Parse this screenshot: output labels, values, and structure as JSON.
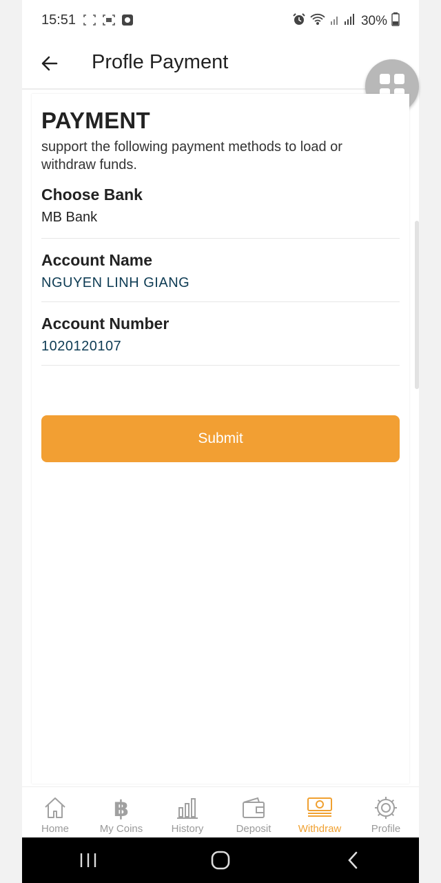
{
  "status_bar": {
    "time": "15:51",
    "battery": "30%"
  },
  "app_bar": {
    "title": "Profle Payment"
  },
  "content": {
    "heading": "PAYMENT",
    "description": "support the following payment methods to load or withdraw funds.",
    "fields": [
      {
        "label": "Choose Bank",
        "value": "MB Bank"
      },
      {
        "label": "Account Name",
        "value": "NGUYEN LINH GIANG"
      },
      {
        "label": "Account Number",
        "value": "1020120107"
      }
    ],
    "submit_label": "Submit"
  },
  "bottom_nav": {
    "items": [
      {
        "label": "Home",
        "icon": "home-icon"
      },
      {
        "label": "My Coins",
        "icon": "bitcoin-icon"
      },
      {
        "label": "History",
        "icon": "bar-chart-icon"
      },
      {
        "label": "Deposit",
        "icon": "wallet-icon"
      },
      {
        "label": "Withdraw",
        "icon": "cash-icon"
      },
      {
        "label": "Profile",
        "icon": "gear-icon"
      }
    ],
    "active_index": 4
  },
  "colors": {
    "accent": "#f29f33",
    "active_nav": "#f0a030",
    "inactive_nav": "#9a9a9a",
    "value_text": "#0d3b53"
  }
}
